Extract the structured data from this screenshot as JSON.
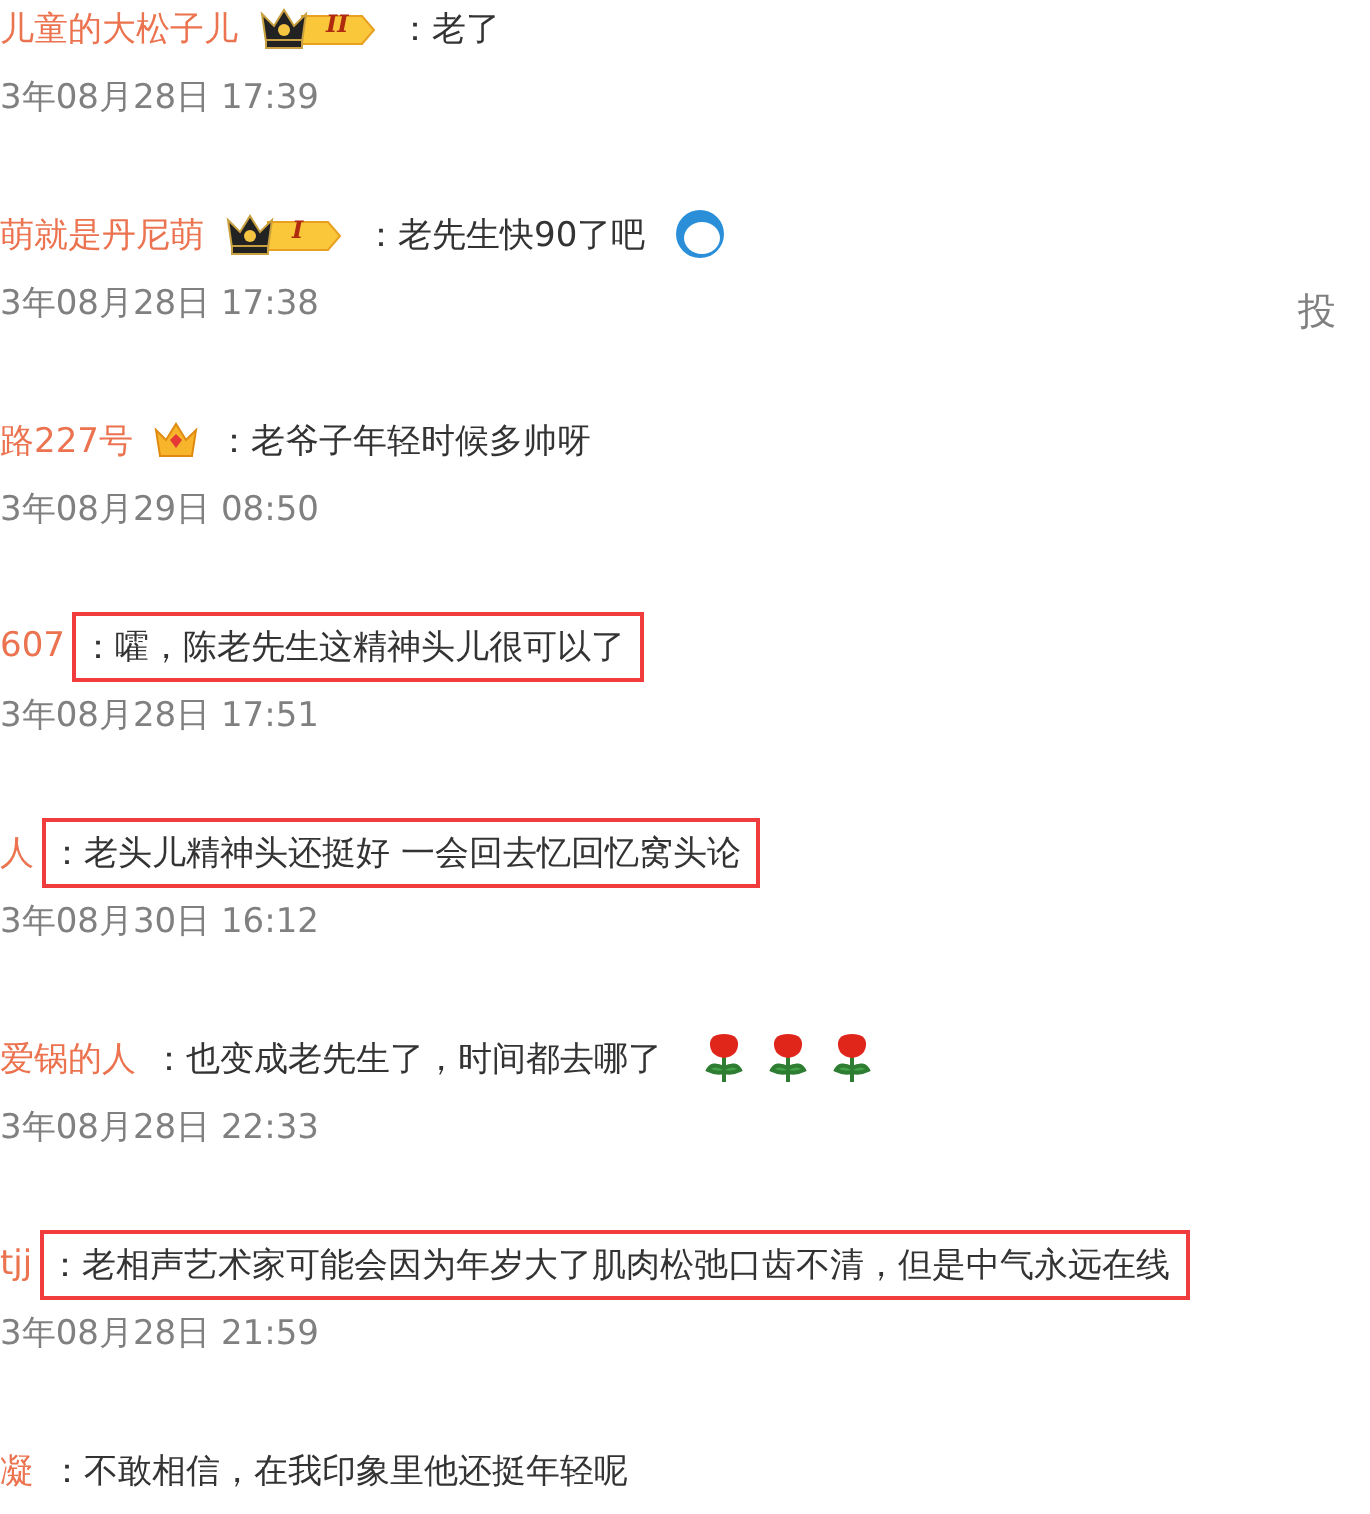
{
  "comments": [
    {
      "name": "儿童的大松子儿",
      "badge": {
        "kind": "crown_black",
        "level": "II"
      },
      "text": "老了",
      "highlighted": false,
      "date": "3年08月28日 17:39"
    },
    {
      "name": "萌就是丹尼萌",
      "badge": {
        "kind": "crown_black",
        "level": "I"
      },
      "text": "老先生快90了吧",
      "emojis": [
        {
          "kind": "face"
        }
      ],
      "highlighted": false,
      "date": "3年08月28日 17:38",
      "report": "投"
    },
    {
      "name": "路227号",
      "badge": {
        "kind": "crown_gold"
      },
      "text": "老爷子年轻时候多帅呀",
      "highlighted": false,
      "date": "3年08月29日 08:50"
    },
    {
      "name": "607",
      "text": "嚯，陈老先生这精神头儿很可以了",
      "highlighted": true,
      "date": "3年08月28日 17:51"
    },
    {
      "name": "人",
      "text": "老头儿精神头还挺好 一会回去忆回忆窝头论",
      "highlighted": true,
      "date": "3年08月30日 16:12"
    },
    {
      "name": "爱锅的人",
      "text": "也变成老先生了，时间都去哪了",
      "emojis": [
        {
          "kind": "rose"
        },
        {
          "kind": "rose"
        },
        {
          "kind": "rose"
        }
      ],
      "highlighted": false,
      "date": "3年08月28日 22:33"
    },
    {
      "name": "tjj",
      "text": "老相声艺术家可能会因为年岁大了肌肉松弛口齿不清，但是中气永远在线",
      "highlighted": true,
      "date": "3年08月28日 21:59"
    },
    {
      "name": "凝",
      "text": "不敢相信，在我印象里他还挺年轻呢",
      "highlighted": false
    }
  ],
  "separator": "："
}
